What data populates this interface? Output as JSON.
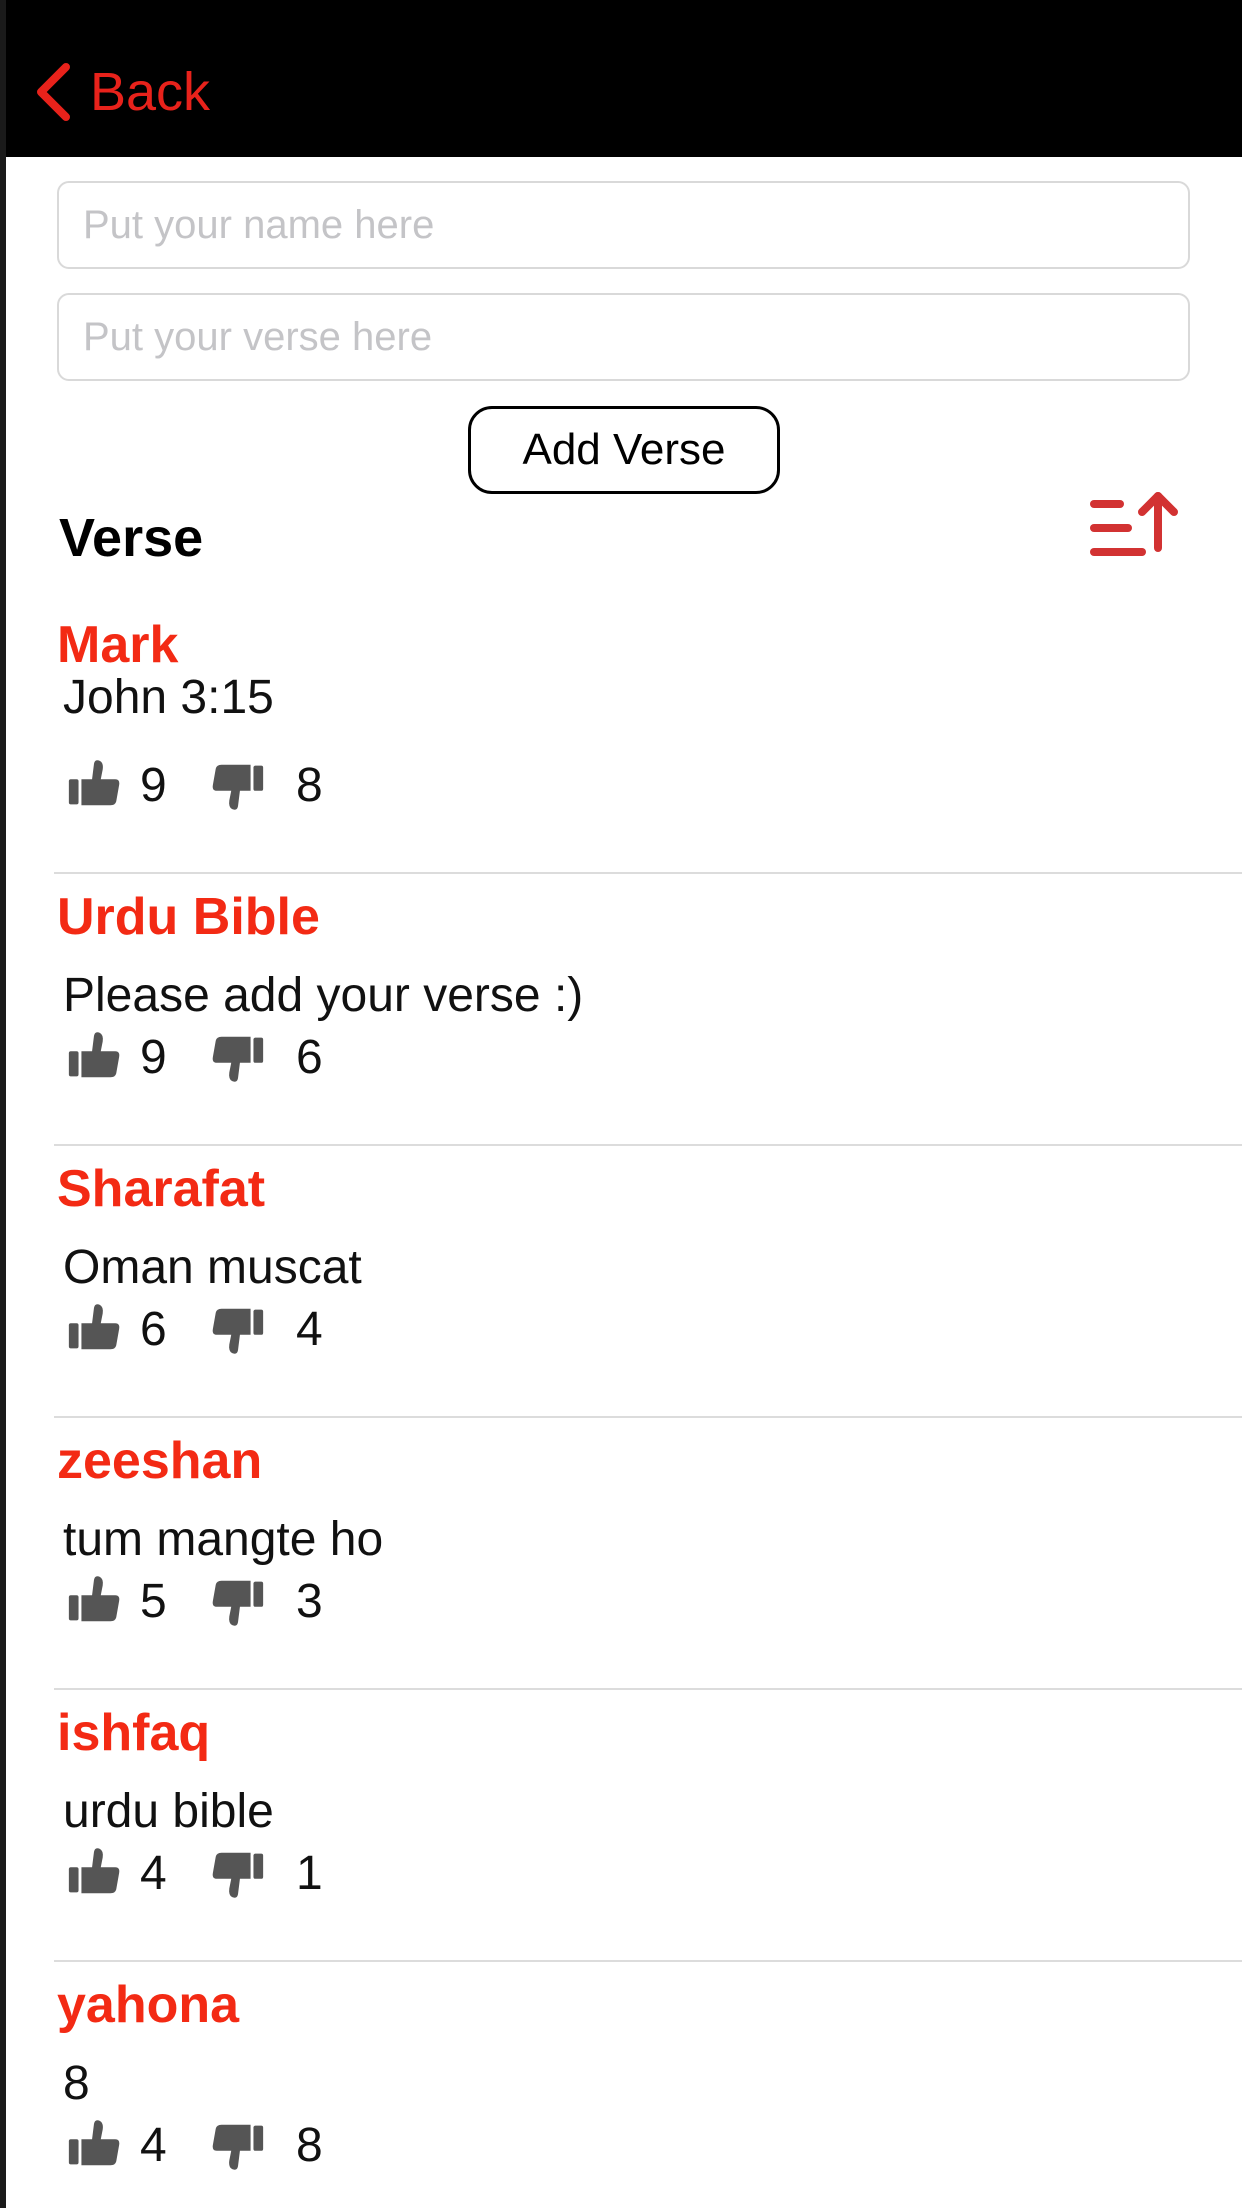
{
  "navbar": {
    "back_label": "Back"
  },
  "form": {
    "name_placeholder": "Put your name here",
    "verse_placeholder": "Put your verse here",
    "add_label": "Add Verse"
  },
  "section": {
    "title": "Verse"
  },
  "colors": {
    "accent": "#f32a14",
    "back": "#e8221b",
    "sort_icon": "#d23232",
    "vote_icon": "#555555"
  },
  "icons": {
    "back": "chevron-left-icon",
    "sort": "sort-ascending-icon",
    "like": "thumbs-up-icon",
    "dislike": "thumbs-down-icon"
  },
  "verses": [
    {
      "name": "Mark",
      "text": "John 3:15",
      "likes": "9",
      "dislikes": "8"
    },
    {
      "name": "Urdu Bible",
      "text": "Please add your verse :)",
      "likes": "9",
      "dislikes": "6"
    },
    {
      "name": "Sharafat",
      "text": "Oman muscat",
      "likes": "6",
      "dislikes": "4"
    },
    {
      "name": "zeeshan",
      "text": "tum mangte ho",
      "likes": "5",
      "dislikes": "3"
    },
    {
      "name": "ishfaq",
      "text": "urdu bible",
      "likes": "4",
      "dislikes": "1"
    },
    {
      "name": "yahona",
      "text": "8",
      "likes": "4",
      "dislikes": "8"
    }
  ]
}
